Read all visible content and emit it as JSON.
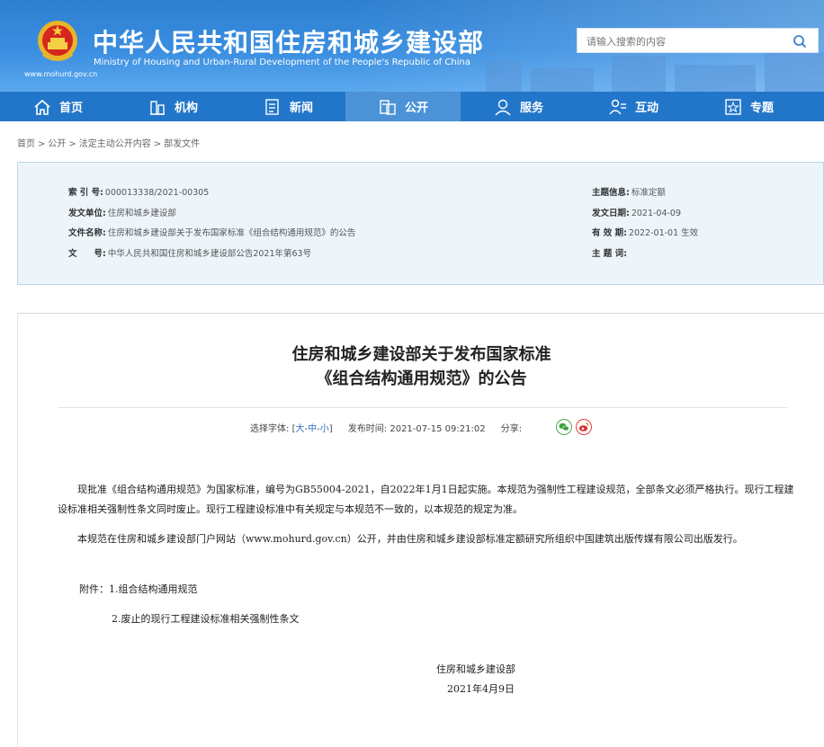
{
  "header": {
    "title_cn": "中华人民共和国住房和城乡建设部",
    "title_en": "Ministry of Housing and Urban-Rural Development of the People's Republic of China",
    "site_url": "www.mohurd.gov.cn",
    "search_placeholder": "请输入搜索的内容"
  },
  "nav": {
    "items": [
      {
        "label": "首页",
        "icon": "home-icon"
      },
      {
        "label": "机构",
        "icon": "org-icon"
      },
      {
        "label": "新闻",
        "icon": "news-icon"
      },
      {
        "label": "公开",
        "icon": "public-icon",
        "active": true
      },
      {
        "label": "服务",
        "icon": "service-icon"
      },
      {
        "label": "互动",
        "icon": "interact-icon"
      },
      {
        "label": "专题",
        "icon": "topic-icon"
      }
    ]
  },
  "breadcrumb": [
    "首页",
    "公开",
    "法定主动公开内容",
    "部发文件"
  ],
  "info": {
    "index_label": "索 引 号:",
    "index_value": "000013338/2021-00305",
    "unit_label": "发文单位:",
    "unit_value": "住房和城乡建设部",
    "name_label": "文件名称:",
    "name_value": "住房和城乡建设部关于发布国家标准《组合结构通用规范》的公告",
    "doc_label": "文　　号:",
    "doc_value": "中华人民共和国住房和城乡建设部公告2021年第63号",
    "topic_label": "主题信息:",
    "topic_value": "标准定额",
    "date_label": "发文日期:",
    "date_value": "2021-04-09",
    "valid_label": "有 效 期:",
    "valid_value": "2022-01-01 生效",
    "subject_label": "主 题 词:",
    "subject_value": ""
  },
  "article": {
    "title_line1": "住房和城乡建设部关于发布国家标准",
    "title_line2": "《组合结构通用规范》的公告",
    "font_label": "选择字体:",
    "font_open": "[",
    "font_large": "大",
    "font_mid": "中",
    "font_small": "小",
    "font_close": "]",
    "font_dash": "-",
    "publish_label": "发布时间:",
    "publish_time": "2021-07-15 09:21:02",
    "share_label": "分享:",
    "p1": "现批准《组合结构通用规范》为国家标准，编号为GB55004-2021，自2022年1月1日起实施。本规范为强制性工程建设规范，全部条文必须严格执行。现行工程建设标准相关强制性条文同时废止。现行工程建设标准中有关规定与本规范不一致的，以本规范的规定为准。",
    "p2": "本规范在住房和城乡建设部门户网站（www.mohurd.gov.cn）公开，并由住房和城乡建设部标准定额研究所组织中国建筑出版传媒有限公司出版发行。",
    "attach1": "附件：1.组合结构通用规范",
    "attach2": "2.废止的现行工程建设标准相关强制性条文",
    "sign_org": "住房和城乡建设部",
    "sign_date": "2021年4月9日"
  }
}
